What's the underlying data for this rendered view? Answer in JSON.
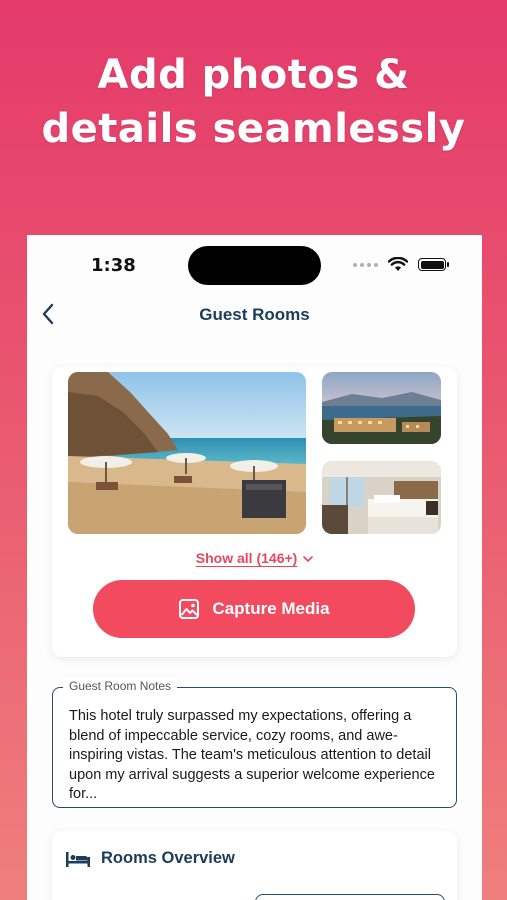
{
  "headline": {
    "line1": "Add photos &",
    "line2": "details seamlessly"
  },
  "status_bar": {
    "time": "1:38"
  },
  "nav": {
    "title": "Guest Rooms",
    "back_icon": "chevron-left-icon"
  },
  "media": {
    "show_all_label": "Show all (146+)",
    "capture_label": "Capture Media",
    "capture_icon": "image-icon",
    "accent_color": "#f24a5e"
  },
  "notes": {
    "legend": "Guest Room Notes",
    "text": "This hotel truly surpassed my expectations, offering a blend of impeccable service, cozy rooms, and awe-inspiring vistas. The team's meticulous attention to detail upon my arrival suggests a superior welcome experience for..."
  },
  "overview": {
    "title": "Rooms Overview",
    "icon": "bed-icon"
  },
  "colors": {
    "background_top": "#e43a6b",
    "background_bottom": "#ef7f7c",
    "navy": "#1c3d5a"
  }
}
